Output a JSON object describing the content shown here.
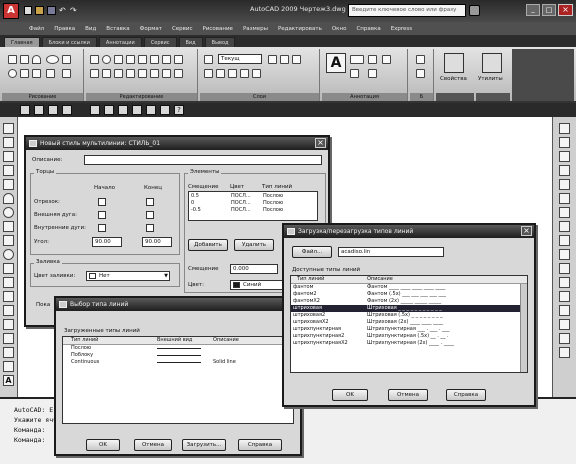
{
  "app": {
    "title_center": "AutoCAD 2009  Чертеж3.dwg",
    "search_placeholder": "Введите ключевое слово или фразу"
  },
  "menu": [
    "Файл",
    "Правка",
    "Вид",
    "Вставка",
    "Формат",
    "Сервис",
    "Рисование",
    "Размеры",
    "Редактировать",
    "Окно",
    "Справка",
    "Express"
  ],
  "ribbon_tabs": [
    {
      "label": "Главная",
      "active": true
    },
    {
      "label": "Блоки и ссылки",
      "active": false
    },
    {
      "label": "Аннотации",
      "active": false
    },
    {
      "label": "Сервис",
      "active": false
    },
    {
      "label": "Вид",
      "active": false
    },
    {
      "label": "Вывод",
      "active": false
    }
  ],
  "ribbon_panels": {
    "draw": "Рисование",
    "modify": "Редактирование",
    "layers": "Слои",
    "annotation": "Аннотация",
    "properties": "Свойства",
    "utilities": "Утилиты",
    "layer_value": "Текущ"
  },
  "cmdline": [
    "AutoCAD: Е",
    "Укажите ячч",
    "Команда:",
    "Команда:"
  ],
  "mls_dialog": {
    "title": "Новый стиль мультилинии: СТИЛЬ_01",
    "description_label": "Описание:",
    "caps": {
      "group": "Торцы",
      "start": "Начало",
      "end": "Конец",
      "segment": "Отрезок:",
      "outer_arc": "Внешняя дуга:",
      "inner_arcs": "Внутренние дуги:",
      "angle": "Угол:",
      "angle_start": "90.00",
      "angle_end": "90.00"
    },
    "fill": {
      "group": "Заливка",
      "label": "Цвет заливки:",
      "value": "Нет"
    },
    "elements": {
      "group": "Элементы",
      "headers": [
        "Смещение",
        "Цвет",
        "Тип линий"
      ],
      "rows": [
        [
          "0.5",
          "ПОСЛ...",
          "Послою"
        ],
        [
          "0",
          "ПОСЛ...",
          "Послою"
        ],
        [
          "-0.5",
          "ПОСЛ...",
          "Послою"
        ]
      ],
      "add": "Добавить",
      "delete": "Удалить",
      "offset_label": "Смещение",
      "offset_value": "0.000",
      "color_label": "Цвет:",
      "color_value": "Синий",
      "color_swatch": "#1a1a1a"
    },
    "show_joints_prefix": "Пока"
  },
  "ltsel_dialog": {
    "title": "Выбор типа линий",
    "loaded_label": "Загруженные типы линий",
    "headers": [
      "Тип линий",
      "Внешний вид",
      "Описание"
    ],
    "rows": [
      {
        "name": "Послою",
        "desc": ""
      },
      {
        "name": "Поблоку",
        "desc": ""
      },
      {
        "name": "Continuous",
        "desc": "Solid line"
      }
    ],
    "ok": "OK",
    "cancel": "Отмена",
    "load": "Загрузить...",
    "help": "Справка"
  },
  "ltload_dialog": {
    "title": "Загрузка/перезагрузка типов линий",
    "file_button": "Файл...",
    "file_value": "acadiso.lin",
    "available_label": "Доступные типы линий",
    "headers": [
      "Тип линий",
      "Описание"
    ],
    "rows": [
      {
        "name": "фантом",
        "desc": "Фантом ____ ____ ____ ____ ____",
        "selected": false
      },
      {
        "name": "фантом2",
        "desc": "Фантом (.5x) ___ ___ ___ ___ ___",
        "selected": false
      },
      {
        "name": "фантомX2",
        "desc": "Фантом (2x) _____ _____ _____",
        "selected": false
      },
      {
        "name": "штриховая",
        "desc": "Штриховая _ _ _ _ _ _ _ _ _ _ _",
        "selected": true
      },
      {
        "name": "штриховая2",
        "desc": "Штриховая (.5x) _ _ _ _ _ _ _ _",
        "selected": false
      },
      {
        "name": "штриховаяX2",
        "desc": "Штриховая (2x) ____ ____ ____",
        "selected": false
      },
      {
        "name": "штрихпунктирная",
        "desc": "Штрихпунктирная ___ . ___ . ___",
        "selected": false
      },
      {
        "name": "штрихпунктирная2",
        "desc": "Штрихпунктирная (.5x) __ . __ .",
        "selected": false
      },
      {
        "name": "штрихпунктирнаяX2",
        "desc": "Штрихпунктирная (2x) ____ . ____",
        "selected": false
      }
    ],
    "ok": "OK",
    "cancel": "Отмена",
    "help": "Справка"
  }
}
